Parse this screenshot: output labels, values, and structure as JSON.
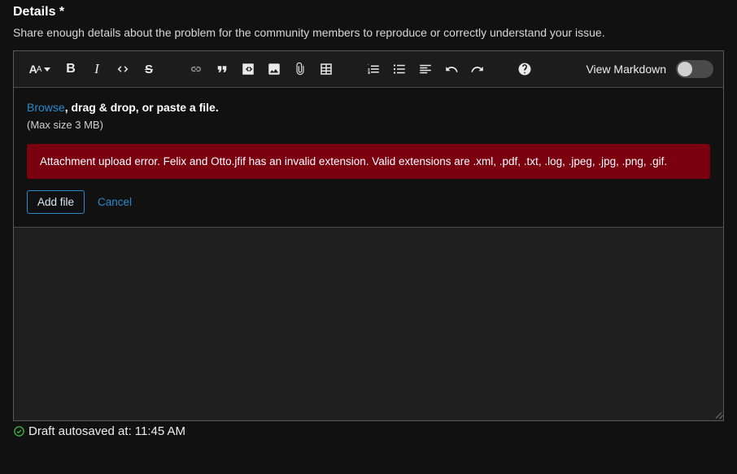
{
  "header": {
    "title": "Details *",
    "subtitle": "Share enough details about the problem for the community members to reproduce or correctly understand your issue."
  },
  "toolbar": {
    "view_markdown_label": "View Markdown",
    "view_markdown_on": false
  },
  "attach": {
    "browse_label": "Browse",
    "rest_label": ", drag & drop, or paste a file.",
    "max_size_label": "(Max size 3 MB)",
    "error_message": "Attachment upload error. Felix and Otto.jfif has an invalid extension. Valid extensions are .xml, .pdf, .txt, .log, .jpeg, .jpg, .png, .gif.",
    "add_file_label": "Add file",
    "cancel_label": "Cancel"
  },
  "footer": {
    "autosave_prefix": "Draft autosaved at: ",
    "autosave_time": "11:45 AM"
  }
}
